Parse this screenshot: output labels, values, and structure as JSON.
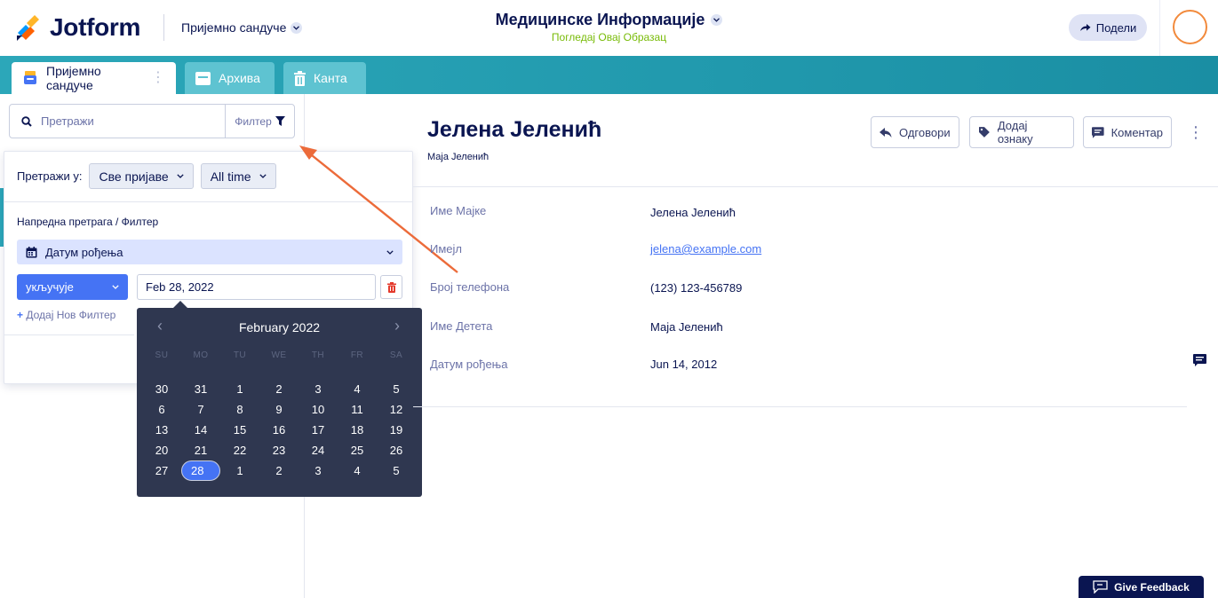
{
  "header": {
    "brand": "Jotform",
    "inbox_switch_label": "Пријемно сандуче",
    "form_title": "Медицинске Информације",
    "form_subtitle": "Погледај Овај Образац",
    "share_label": "Подели"
  },
  "tabs": [
    {
      "label": "Пријемно сандуче"
    },
    {
      "label": "Архива"
    },
    {
      "label": "Канта"
    }
  ],
  "search": {
    "placeholder": "Претражи",
    "filter_label": "Филтер"
  },
  "filter_panel": {
    "search_in_label": "Претражи у:",
    "scope_value": "Све пријаве",
    "time_value": "All time",
    "advanced_label": "Напредна претрага / Филтер",
    "field_value": "Датум рођења",
    "operator_value": "укључује",
    "date_value": "Feb 28, 2022",
    "add_filter_label": "Додај Нов Филтер"
  },
  "calendar": {
    "month_label": "February 2022",
    "weekdays": [
      "SU",
      "MO",
      "TU",
      "WE",
      "TH",
      "FR",
      "SA"
    ],
    "weeks": [
      [
        "30",
        "31",
        "1",
        "2",
        "3",
        "4",
        "5"
      ],
      [
        "6",
        "7",
        "8",
        "9",
        "10",
        "11",
        "12"
      ],
      [
        "13",
        "14",
        "15",
        "16",
        "17",
        "18",
        "19"
      ],
      [
        "20",
        "21",
        "22",
        "23",
        "24",
        "25",
        "26"
      ],
      [
        "27",
        "28",
        "1",
        "2",
        "3",
        "4",
        "5"
      ]
    ],
    "selected_day": "28"
  },
  "submission": {
    "name": "Јелена Јеленић",
    "subtitle": "Маја Јеленић",
    "actions": {
      "reply": "Одговори",
      "tag": "Додај ознаку",
      "comment": "Коментар"
    },
    "fields": [
      {
        "label": "Име Мајке",
        "value": "Јелена Јеленић"
      },
      {
        "label": "Имејл",
        "value": "jelena@example.com"
      },
      {
        "label": "Број телефона",
        "value": "(123) 123-456789"
      },
      {
        "label": "Име Детета",
        "value": "Маја Јеленић"
      },
      {
        "label": "Датум рођења",
        "value": "Jun 14, 2012"
      }
    ]
  },
  "feedback_label": "Give Feedback",
  "colors": {
    "brand_navy": "#0a1551",
    "accent_blue": "#4573f4",
    "tab_teal": "#2ca7b9",
    "annotation_orange": "#ec6b3a",
    "calendar_bg": "#2f3750"
  }
}
